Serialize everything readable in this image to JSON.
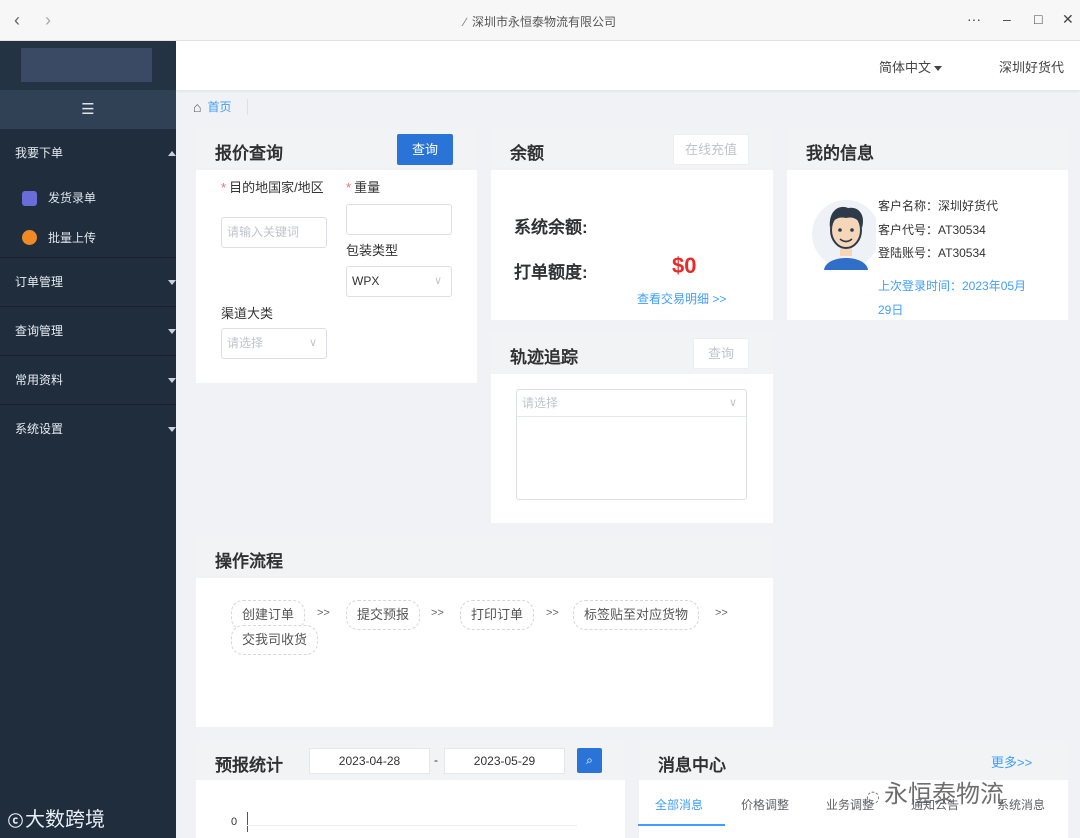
{
  "browser": {
    "title": "深圳市永恒泰物流有限公司",
    "controls": [
      "···",
      "–",
      "□",
      "✕"
    ]
  },
  "sidebar": {
    "collapse_icon": "☰",
    "sections": [
      {
        "label": "我要下单",
        "expanded": true,
        "items": [
          {
            "label": "发货录单",
            "icon": "document-icon"
          },
          {
            "label": "批量上传",
            "icon": "upload-icon"
          }
        ]
      },
      {
        "label": "订单管理",
        "expanded": false
      },
      {
        "label": "查询管理",
        "expanded": false
      },
      {
        "label": "常用资料",
        "expanded": false
      },
      {
        "label": "系统设置",
        "expanded": false
      }
    ]
  },
  "header": {
    "language": "简体中文",
    "user": "深圳好货代"
  },
  "breadcrumb": {
    "home": "首页"
  },
  "quote": {
    "title": "报价查询",
    "query_button": "查询",
    "dest_label": "目的地国家/地区",
    "dest_placeholder": "请输入关键词",
    "weight_label": "重量",
    "weight_value": "",
    "package_label": "包装类型",
    "package_value": "WPX",
    "channel_label": "渠道大类",
    "channel_placeholder": "请选择"
  },
  "balance": {
    "title": "余额",
    "recharge_button": "在线充值",
    "system_balance_label": "系统余额:",
    "system_balance_value": "",
    "print_quota_label": "打单额度:",
    "print_quota_value": "$0",
    "details_link": "查看交易明细 >>"
  },
  "tracking": {
    "title": "轨迹追踪",
    "query_button": "查询",
    "select_placeholder": "请选择"
  },
  "my_info": {
    "title": "我的信息",
    "customer_name": "客户名称：深圳好货代",
    "customer_code": "客户代号：AT30534",
    "login_account": "登陆账号：AT30534",
    "last_login_1": "上次登录时间：2023年05月",
    "last_login_2": "29日"
  },
  "workflow": {
    "title": "操作流程",
    "steps": [
      "创建订单",
      "提交预报",
      "打印订单",
      "标签贴至对应货物",
      "交我司收货"
    ],
    "arrow": ">>"
  },
  "forecast": {
    "title": "预报统计",
    "start_date": "2023-04-28",
    "date_sep": "-",
    "end_date": "2023-05-29",
    "y_tick": "0"
  },
  "messages": {
    "title": "消息中心",
    "more_link": "更多>>",
    "tabs": [
      "全部消息",
      "价格调整",
      "业务调整",
      "通知公告",
      "系统消息"
    ]
  },
  "watermarks": {
    "left": "大数跨境",
    "right": "永恒泰物流"
  }
}
